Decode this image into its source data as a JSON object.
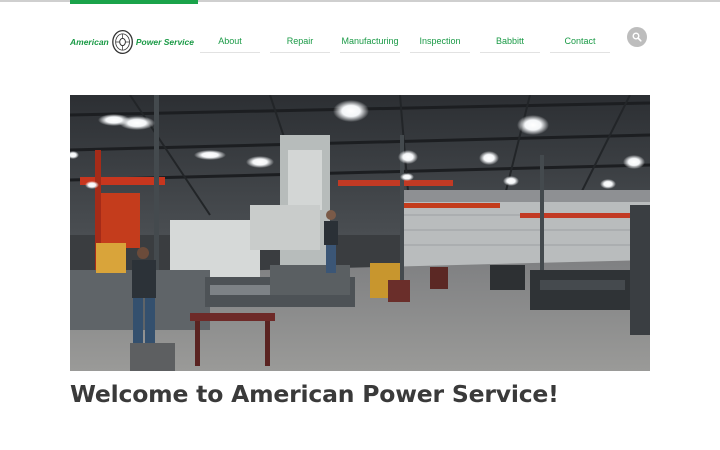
{
  "brand": {
    "left_text": "American",
    "right_text": "Power Service",
    "logo_alt": "American Power Service logo"
  },
  "nav": {
    "items": [
      {
        "label": "About"
      },
      {
        "label": "Repair"
      },
      {
        "label": "Manufacturing"
      },
      {
        "label": "Inspection"
      },
      {
        "label": "Babbitt"
      },
      {
        "label": "Contact"
      }
    ]
  },
  "search": {
    "icon": "search-icon"
  },
  "hero": {
    "alt": "Machine shop floor with industrial equipment"
  },
  "main": {
    "headline": "Welcome to American Power Service!"
  },
  "colors": {
    "brand_green": "#1aa34a",
    "headline": "#3a3a3a",
    "search_bg": "#bdbdbd"
  }
}
